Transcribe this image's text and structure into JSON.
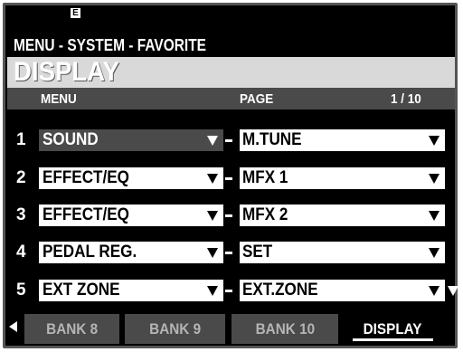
{
  "status_icon": "E",
  "breadcrumb": "MENU - SYSTEM - FAVORITE",
  "title": "DISPLAY",
  "columns": {
    "menu": "MENU",
    "page": "PAGE",
    "page_indicator": "1 / 10"
  },
  "rows": [
    {
      "num": "1",
      "menu": "SOUND",
      "page": "M.TUNE",
      "selected": true
    },
    {
      "num": "2",
      "menu": "EFFECT/EQ",
      "page": "MFX 1",
      "selected": false
    },
    {
      "num": "3",
      "menu": "EFFECT/EQ",
      "page": "MFX 2",
      "selected": false
    },
    {
      "num": "4",
      "menu": "PEDAL REG.",
      "page": "SET",
      "selected": false
    },
    {
      "num": "5",
      "menu": "EXT ZONE",
      "page": "EXT.ZONE",
      "selected": false
    }
  ],
  "tabs": [
    {
      "label": "BANK 8",
      "active": false
    },
    {
      "label": "BANK 9",
      "active": false
    },
    {
      "label": "BANK 10",
      "active": false
    },
    {
      "label": "DISPLAY",
      "active": true
    }
  ],
  "icons": {
    "scroll_left": "triangle-left-icon",
    "scroll_down": "triangle-down-icon",
    "dropdown": "triangle-down-icon"
  },
  "colors": {
    "background": "#000000",
    "highlight": "#4a4a4a",
    "field": "#ffffff",
    "titlebar": "#d9d9d9"
  }
}
